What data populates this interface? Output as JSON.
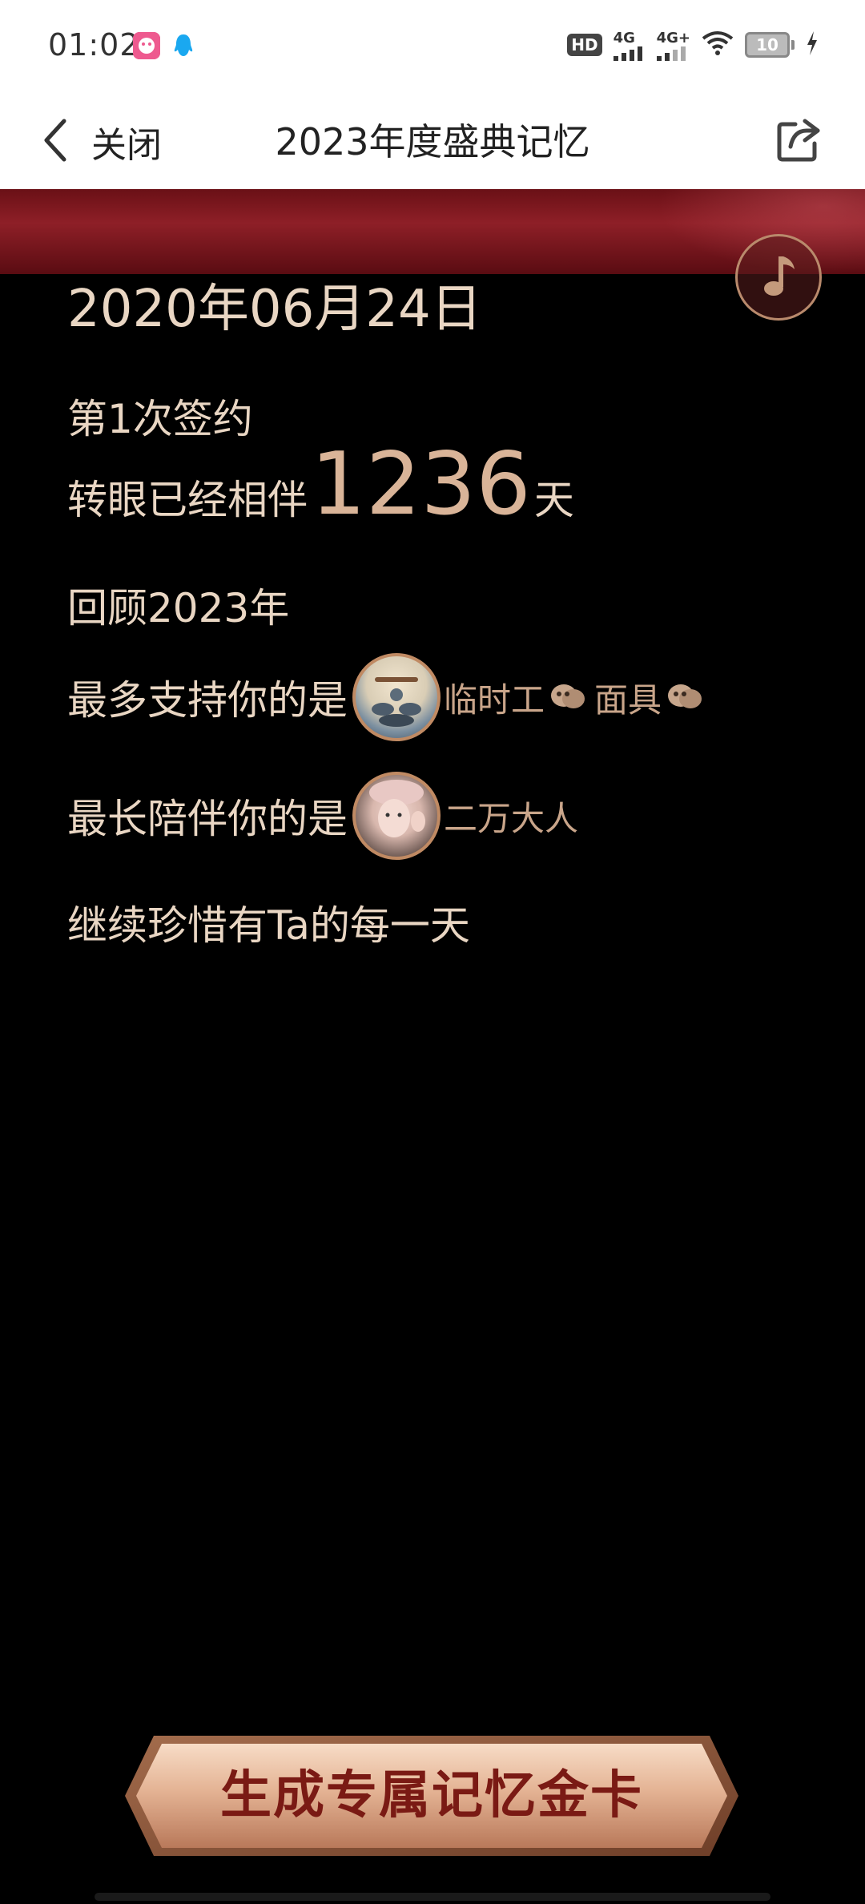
{
  "status_bar": {
    "time": "01:02",
    "hd": "HD",
    "net1": "4G",
    "net2": "4G+",
    "battery": "10"
  },
  "nav": {
    "back_label": "关闭",
    "title": "2023年度盛典记忆"
  },
  "content": {
    "date": "2020年06月24日",
    "sign_count": "第1次签约",
    "days_prefix": "转眼已经相伴",
    "days_number": "1236",
    "days_suffix": "天",
    "review_title": "回顾2023年",
    "supporter_label": "最多支持你的是",
    "supporter_name_1": "临时工",
    "supporter_name_2": "面具",
    "companion_label": "最长陪伴你的是",
    "companion_name": "二万大人",
    "cherish": "继续珍惜有Ta的每一天"
  },
  "button": {
    "label": "生成专属记忆金卡"
  },
  "colors": {
    "background": "#000000",
    "text": "#e9d6c3",
    "accent": "#c9a58a",
    "banner": "#8e1f27",
    "button_text": "#7a1a14"
  }
}
